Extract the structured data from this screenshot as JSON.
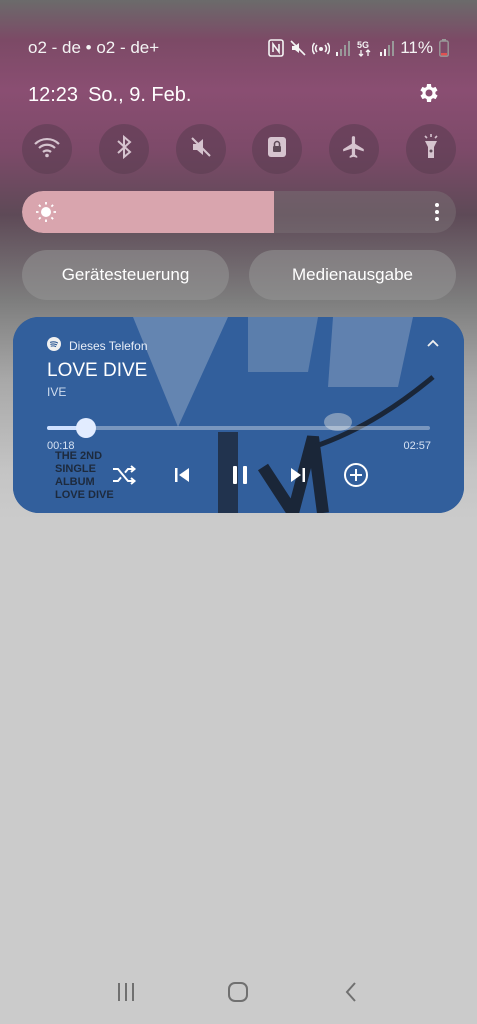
{
  "status_bar": {
    "carrier": "o2 - de • o2 - de+",
    "battery": "11%",
    "icons": [
      "nfc-icon",
      "mute-icon",
      "hotspot-icon",
      "signal-icon",
      "5g-icon",
      "signal-icon",
      "battery-icon"
    ],
    "network_badge": "5G"
  },
  "header": {
    "time": "12:23",
    "date": "So., 9. Feb."
  },
  "quick_tiles": [
    {
      "icon": "wifi-icon"
    },
    {
      "icon": "bluetooth-icon"
    },
    {
      "icon": "sound-off-icon"
    },
    {
      "icon": "rotation-lock-icon"
    },
    {
      "icon": "airplane-icon"
    },
    {
      "icon": "flashlight-icon"
    }
  ],
  "brightness": {
    "level": 0.58,
    "fill_color": "#d9a5ae"
  },
  "buttons": {
    "device_control": "Gerätesteuerung",
    "media_output": "Medienausgabe"
  },
  "media": {
    "source": "Dieses Telefon",
    "title": "LOVE DIVE",
    "artist": "IVE",
    "elapsed": "00:18",
    "total": "02:57",
    "progress": 0.102,
    "album_text": [
      "THE 2ND",
      "SINGLE",
      "ALBUM",
      "LOVE DIVE"
    ],
    "accent": "#2f5a96"
  },
  "nav": {
    "icons": [
      "recent-apps-icon",
      "home-icon",
      "back-icon"
    ]
  }
}
